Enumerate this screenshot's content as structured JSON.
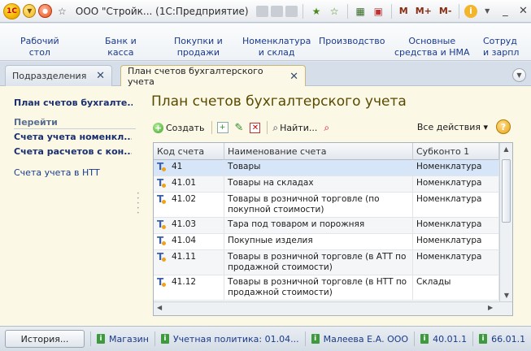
{
  "titlebar": {
    "logo": "1С",
    "title": "ООО \"Стройк... (1С:Предприятие)",
    "m_buttons": [
      "M",
      "M+",
      "M-"
    ],
    "info": "i",
    "minimize": "_",
    "close": "✕"
  },
  "sections": [
    {
      "label": "Рабочий\nстол"
    },
    {
      "label": "Банк и\nкасса"
    },
    {
      "label": "Покупки и\nпродажи"
    },
    {
      "label": "Номенклатура\nи склад"
    },
    {
      "label": "Производство"
    },
    {
      "label": "Основные\nсредства и НМА"
    },
    {
      "label": "Сотруд\nи зарпл"
    }
  ],
  "tabs": [
    {
      "label": "Подразделения",
      "active": false
    },
    {
      "label": "План счетов бухгалтерского учета",
      "active": true
    }
  ],
  "left_panel": {
    "current": "План счетов бухгалте...",
    "goto_heading": "Перейти",
    "links": [
      "Счета учета номенкл...",
      "Счета расчетов с кон..."
    ],
    "extra_link": "Счета учета в НТТ"
  },
  "form": {
    "title": "План счетов бухгалтерского учета",
    "create_label": "Создать",
    "find_label": "Найти...",
    "all_actions_label": "Все действия ▾",
    "help": "?"
  },
  "table": {
    "headers": [
      "Код счета",
      "Наименование счета",
      "Субконто 1"
    ],
    "rows": [
      {
        "code": "41",
        "name": "Товары",
        "sub1": "Номенклатура",
        "selected": true
      },
      {
        "code": "41.01",
        "name": "Товары на складах",
        "sub1": "Номенклатура",
        "selected": false
      },
      {
        "code": "41.02",
        "name": "Товары в розничной торговле (по покупной стоимости)",
        "sub1": "Номенклатура",
        "selected": false
      },
      {
        "code": "41.03",
        "name": "Тара под товаром и порожняя",
        "sub1": "Номенклатура",
        "selected": false
      },
      {
        "code": "41.04",
        "name": "Покупные изделия",
        "sub1": "Номенклатура",
        "selected": false
      },
      {
        "code": "41.11",
        "name": "Товары в розничной торговле (в АТТ по продажной стоимости)",
        "sub1": "Номенклатура",
        "selected": false
      },
      {
        "code": "41.12",
        "name": "Товары в розничной торговле (в НТТ по продажной стоимости)",
        "sub1": "Склады",
        "selected": false
      }
    ]
  },
  "statusbar": {
    "history_label": "История...",
    "items": [
      "Магазин",
      "Учетная политика: 01.04...",
      "Малеева Е.А. ООО",
      "40.01.1",
      "66.01.1"
    ]
  },
  "colors": {
    "accent": "#1a3a8a",
    "content_bg": "#fbf8e6",
    "selected_row": "#d6e6f8"
  }
}
